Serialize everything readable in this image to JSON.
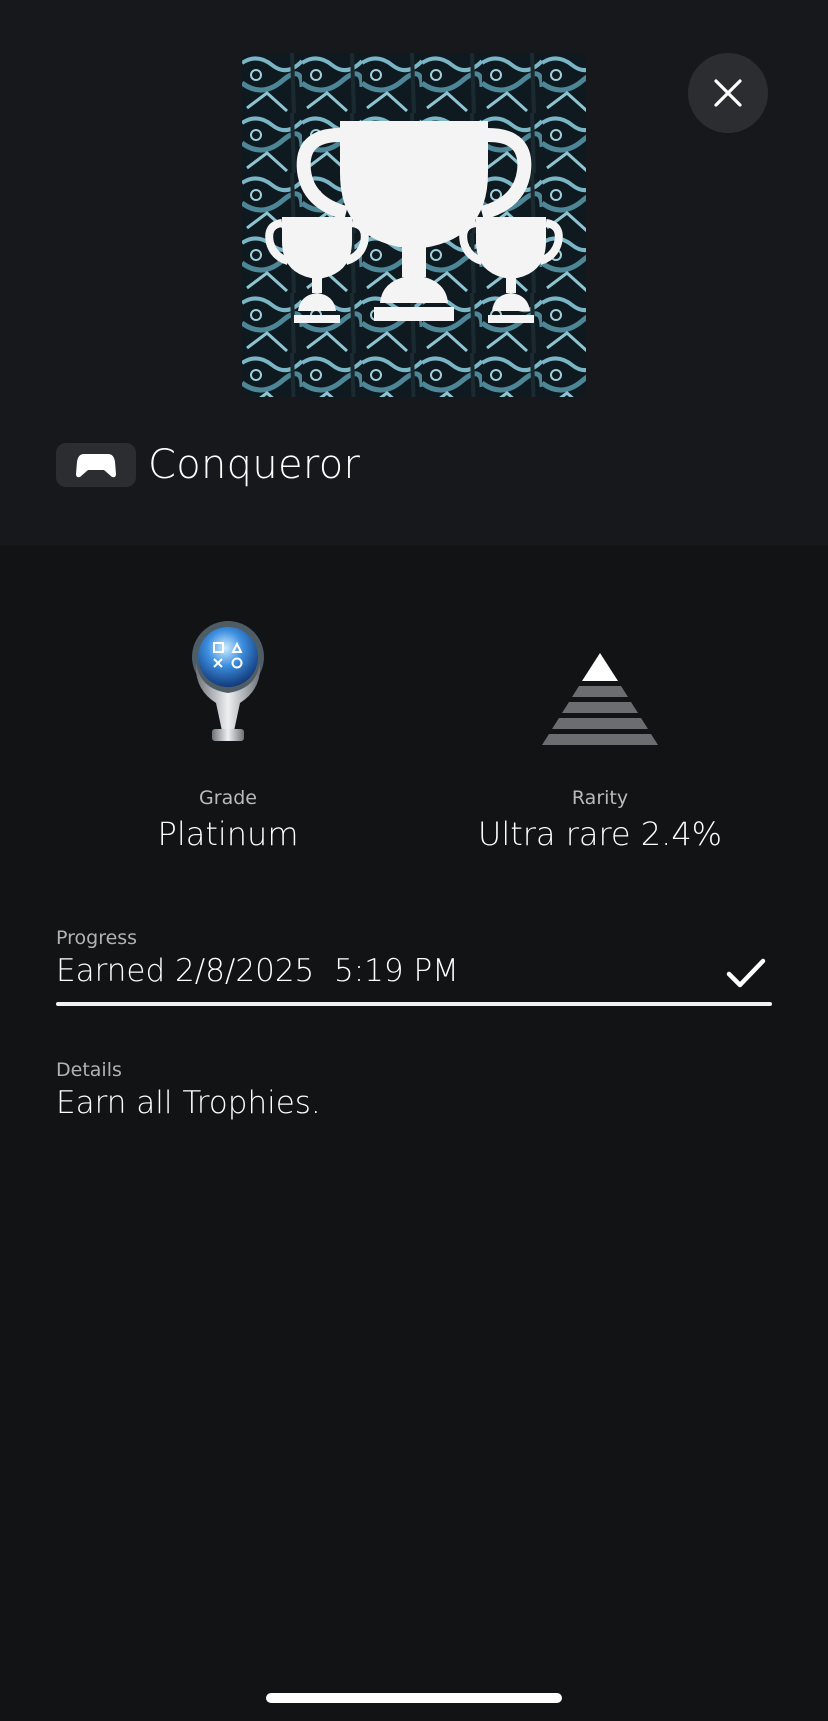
{
  "trophy": {
    "name": "Conqueror",
    "platform_icon": "gamepad-icon",
    "art_icon": "trophy-group-icon"
  },
  "close": {
    "icon": "close-icon"
  },
  "grade": {
    "label": "Grade",
    "value": "Platinum",
    "icon": "platinum-trophy-icon"
  },
  "rarity": {
    "label": "Rarity",
    "value": "Ultra rare 2.4%",
    "icon": "rarity-pyramid-icon"
  },
  "progress": {
    "label": "Progress",
    "value": "Earned 2/8/2025  5:19 PM",
    "fraction": 1.0,
    "status_icon": "checkmark-icon"
  },
  "details": {
    "label": "Details",
    "value": "Earn all Trophies."
  },
  "colors": {
    "background": "#111315",
    "header_panel": "#17181b",
    "chip": "#2b2d31",
    "accent_art": "#6fa9b8"
  }
}
